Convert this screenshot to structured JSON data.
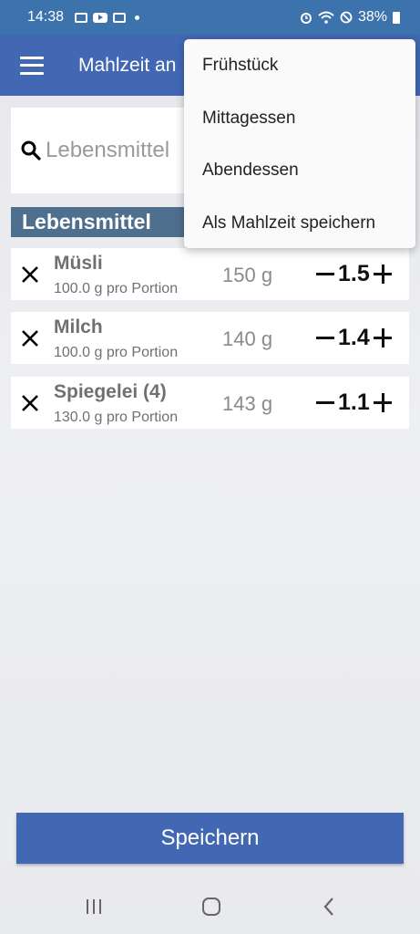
{
  "status_bar": {
    "time": "14:38",
    "battery": "38%",
    "icons": [
      "gallery-icon",
      "youtube-icon",
      "calendar-icon",
      "notification-dot-icon",
      "alarm-icon",
      "wifi-icon",
      "do-not-disturb-icon",
      "battery-icon"
    ]
  },
  "app_bar": {
    "title": "Mahlzeit an",
    "menu_icon": "hamburger-menu-icon"
  },
  "search": {
    "placeholder": "Lebensmittel",
    "value": "",
    "icon": "search-icon"
  },
  "section": {
    "title": "Lebensmittel"
  },
  "foods": [
    {
      "name": "Müsli",
      "portion": "100.0 g pro Portion",
      "weight": "150 g",
      "quantity": "1.5"
    },
    {
      "name": "Milch",
      "portion": "100.0 g pro Portion",
      "weight": "140 g",
      "quantity": "1.4"
    },
    {
      "name": "Spiegelei (4)",
      "portion": "130.0 g pro Portion",
      "weight": "143 g",
      "quantity": "1.1"
    }
  ],
  "menu": {
    "items": [
      "Frühstück",
      "Mittagessen",
      "Abendessen",
      "Als Mahlzeit speichern"
    ]
  },
  "save_button": {
    "label": "Speichern"
  },
  "colors": {
    "status_bar": "#3d73ad",
    "app_bar": "#4268b4",
    "section_header": "#4f6f8f",
    "save_button": "#4268b4",
    "background": "#eceef1"
  }
}
